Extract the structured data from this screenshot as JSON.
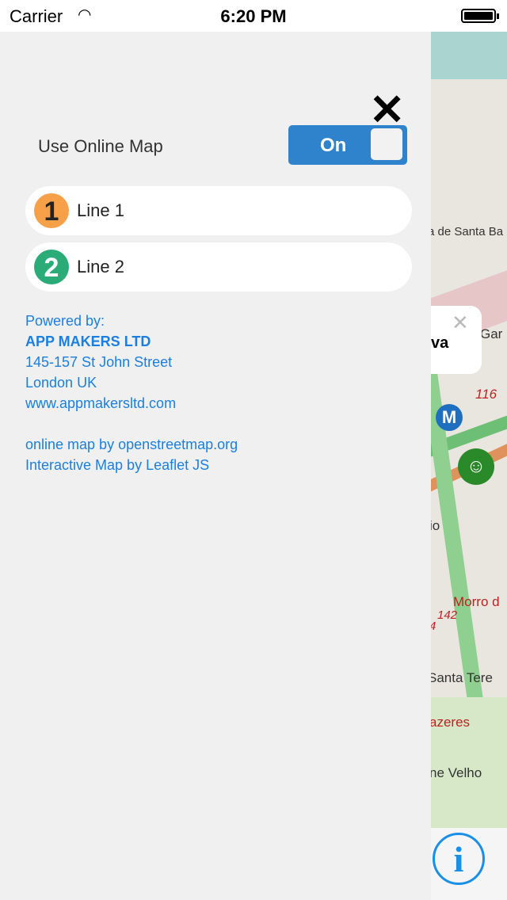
{
  "status": {
    "carrier": "Carrier",
    "time": "6:20 PM"
  },
  "settings": {
    "online_map_label": "Use Online Map",
    "toggle_label": "On",
    "toggle_on": true
  },
  "lines": [
    {
      "number": "1",
      "label": "Line 1",
      "color": "#f7a04a"
    },
    {
      "number": "2",
      "label": "Line 2",
      "color": "#2bab77"
    }
  ],
  "credits": {
    "powered_by": "Powered by:",
    "company": "APP MAKERS LTD",
    "address1": "145-157 St John Street",
    "address2": "London UK",
    "website": "www.appmakersltd.com",
    "map_credit": "online map by openstreetmap.org",
    "leaflet_credit": "Interactive Map by Leaflet JS"
  },
  "map": {
    "labels": [
      "a de Santa Ba",
      "Gar",
      "va",
      "116",
      "io",
      "4",
      "Morro d",
      "142",
      "Santa Tere",
      "azeres",
      "ne Velho"
    ]
  },
  "colors": {
    "accent": "#2f82cc",
    "link": "#1a7fe0"
  }
}
